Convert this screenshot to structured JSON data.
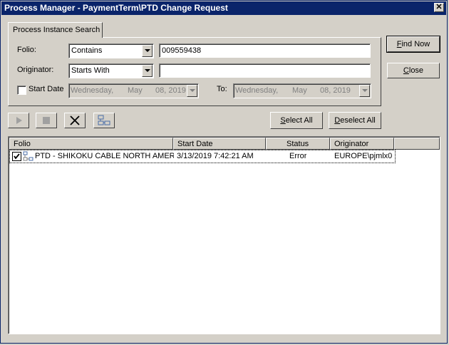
{
  "window": {
    "title": "Process Manager - PaymentTerm\\PTD Change Request",
    "close_glyph": "✕"
  },
  "tab": {
    "label": "Process Instance Search"
  },
  "search": {
    "folio_label": "Folio:",
    "folio_mode": "Contains",
    "folio_value": "009559438",
    "originator_label": "Originator:",
    "originator_mode": "Starts With",
    "originator_value": "",
    "start_date_label": "Start Date",
    "start_date_checked": false,
    "from_date": {
      "weekday": "Wednesday,",
      "month": "May",
      "daynum": "08, 2019"
    },
    "to_label": "To:",
    "to_date": {
      "weekday": "Wednesday,",
      "month": "May",
      "daynum": "08, 2019"
    }
  },
  "buttons": {
    "find_now": {
      "u": "F",
      "rest": "ind Now"
    },
    "close": {
      "u": "C",
      "rest": "lose"
    },
    "select_all": {
      "u": "S",
      "rest": "elect All"
    },
    "deselect_all": {
      "u": "D",
      "rest": "eselect All"
    }
  },
  "toolbar": {
    "icons": [
      "play-icon",
      "stop-icon",
      "delete-icon",
      "process-map-icon"
    ]
  },
  "list": {
    "columns": [
      "Folio",
      "Start Date",
      "Status",
      "Originator"
    ],
    "rows": [
      {
        "checked": true,
        "folio": "PTD - SHIKOKU CABLE NORTH AMERI...",
        "start_date": "3/13/2019 7:42:21 AM",
        "status": "Error",
        "originator": "EUROPE\\pjmlx0"
      }
    ]
  }
}
